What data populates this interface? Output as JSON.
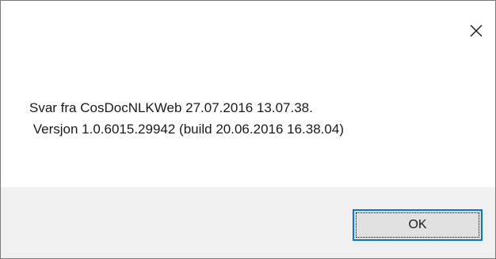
{
  "dialog": {
    "message_line1": "Svar fra CosDocNLKWeb 27.07.2016 13.07.38.",
    "message_line2": " Versjon 1.0.6015.29942 (build 20.06.2016 16.38.04)",
    "ok_label": "OK"
  },
  "colors": {
    "accent": "#0078d7",
    "footer_bg": "#f0f0f0",
    "button_bg": "#e1e1e1"
  },
  "icons": {
    "close": "close-icon"
  }
}
